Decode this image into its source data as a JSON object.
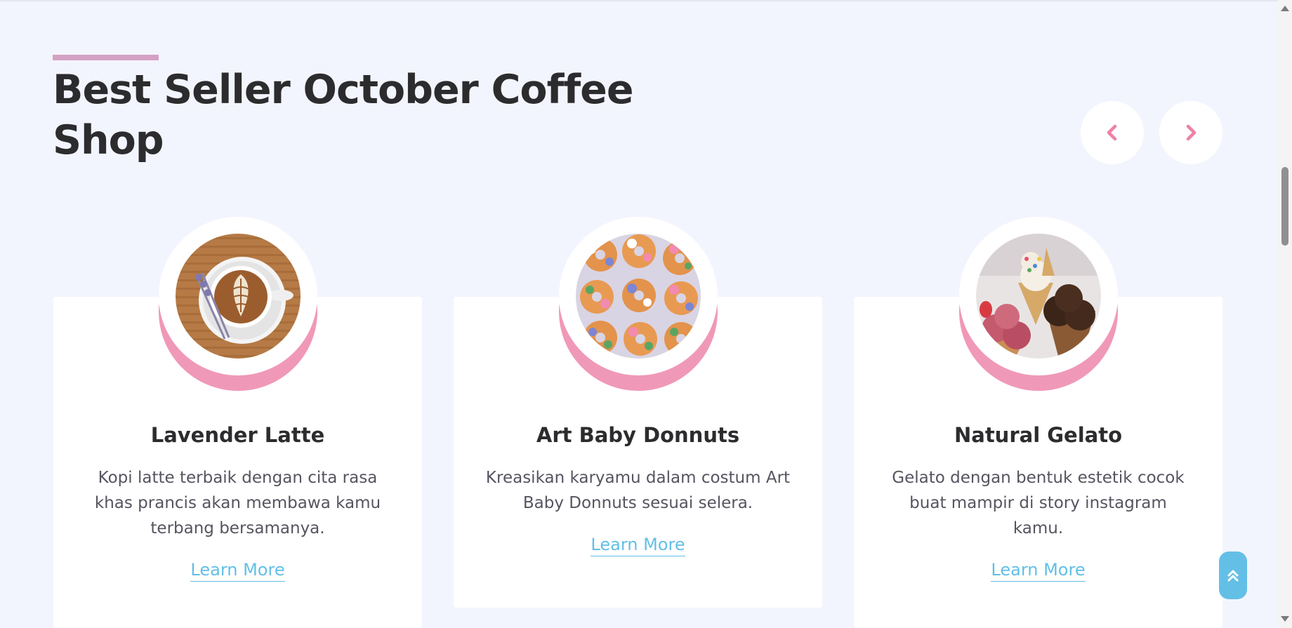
{
  "section": {
    "title": "Best Seller October Coffee Shop",
    "accent_color": "#d4a1c4"
  },
  "carousel_nav": {
    "prev_icon": "chevron-left-icon",
    "next_icon": "chevron-right-icon",
    "icon_color": "#f080a8"
  },
  "products": [
    {
      "title": "Lavender Latte",
      "description": "Kopi latte terbaik dengan cita rasa khas prancis akan membawa kamu terbang bersamanya.",
      "link_label": "Learn More",
      "image": "latte-art-photo"
    },
    {
      "title": "Art Baby Donnuts",
      "description": "Kreasikan karyamu dalam costum Art Baby Donnuts sesuai selera.",
      "link_label": "Learn More",
      "image": "flower-donuts-photo"
    },
    {
      "title": "Natural Gelato",
      "description": "Gelato dengan bentuk estetik cocok buat mampir di story instagram kamu.",
      "link_label": "Learn More",
      "image": "gelato-cones-photo"
    }
  ],
  "scroll_top": {
    "icon": "double-chevron-up-icon",
    "color": "#63bfe6"
  },
  "colors": {
    "background": "#f3f5fe",
    "card": "#ffffff",
    "circle_shadow": "#f098b8",
    "link": "#63bfe6",
    "heading": "#2c2c2e"
  }
}
